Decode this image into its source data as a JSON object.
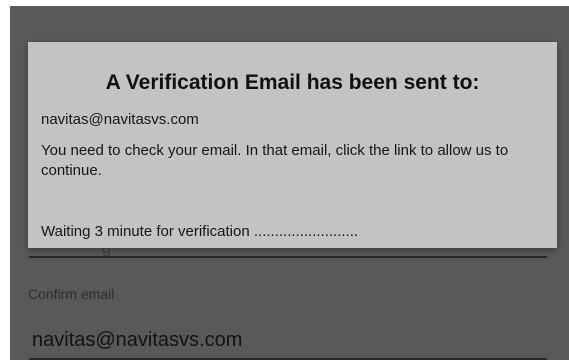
{
  "background_form": {
    "partial_field_glyph": "g",
    "confirm_email_label": "Confirm email",
    "confirm_email_value": "navitas@navitasvs.com"
  },
  "dialog": {
    "title": "A Verification Email has been sent to:",
    "email": "navitas@navitasvs.com",
    "message": "You need to check your email. In that email, click the link to allow us to continue.",
    "waiting_text": "Waiting 3 minute for verification ........................."
  },
  "colors": {
    "overlay": "#595959",
    "dialog_background": "#c3c3c5",
    "text": "#161616"
  }
}
